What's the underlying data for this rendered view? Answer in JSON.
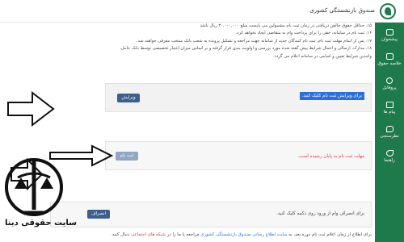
{
  "header": {
    "brand": "صندوق بازنشستگی کشوری"
  },
  "sidebar": {
    "items": [
      {
        "label": "پیشخوان",
        "icon": "home-icon"
      },
      {
        "label": "خلاصه حقوق",
        "icon": "document-icon"
      },
      {
        "label": "پروفایل",
        "icon": "user-icon"
      },
      {
        "label": "پیام ها",
        "icon": "mail-icon"
      },
      {
        "label": "نظرسنجی",
        "icon": "comment-icon"
      },
      {
        "label": "راهنما",
        "icon": "help-icon"
      }
    ]
  },
  "notes": {
    "line1": "۱۵. حداقل حقوق خالص دریافتی در زمان ثبت نام مشمولین می بایست مبلغ ۳۰,۰۰۰,۰۰۰ ریال باشد",
    "line2": "۱۶. ثبت نام در سامانه، حقی را برای پرداخت وام به متقاضی ایجاد نخواهد کرد.",
    "line3": "۱۷. پس از اتمام مهلت ثبت نام، ثبت نام کنندگان جدید از سامانه جهت مراجعه و تشکیل پرونده به شعب بانک منتخب معرفی خواهند شد.",
    "line4": "۱۸. مدارک، ارسالی و اعمال شرایط پیش گفته شده مورد بررسی و اولویت بندی قرار گرفته و بر اساس میزان اعتبار تخصیصی توسط بانک عامل،",
    "line5": "واجدین شرایط تعیین و اسامی در سامانه اعلام می گردد."
  },
  "box_edit": {
    "message": "برای ویرایش ثبت نام کلیک کنید.",
    "button": "ویرایش"
  },
  "box_register": {
    "message": "مهلت ثبت نام به پایان رسیده است.",
    "button": "ثبت نام"
  },
  "box_cancel": {
    "message": "برای انصراف وام از ورود روی دکمه کلیک کنید.",
    "button": "انصراف"
  },
  "footer": {
    "text_before": "برای اطلاع از زمان اعلام ثبت نام دوره بعد، به",
    "link_site": "سایت اطلاع رسانی صندوق بازنشستگی کشوری",
    "text_middle": "مراجعه یا ما را در",
    "link_social": "شبکه های اجتماعی",
    "text_after": "دنبال کنید."
  },
  "watermark": {
    "text": "سایت حقوقی دینا"
  },
  "colors": {
    "sidebar": "#1f7a4b",
    "primary_button": "#3d5f8c",
    "disabled_button": "#8fa7c2",
    "highlight": "#2d6fd9",
    "error": "#d83a3a"
  }
}
